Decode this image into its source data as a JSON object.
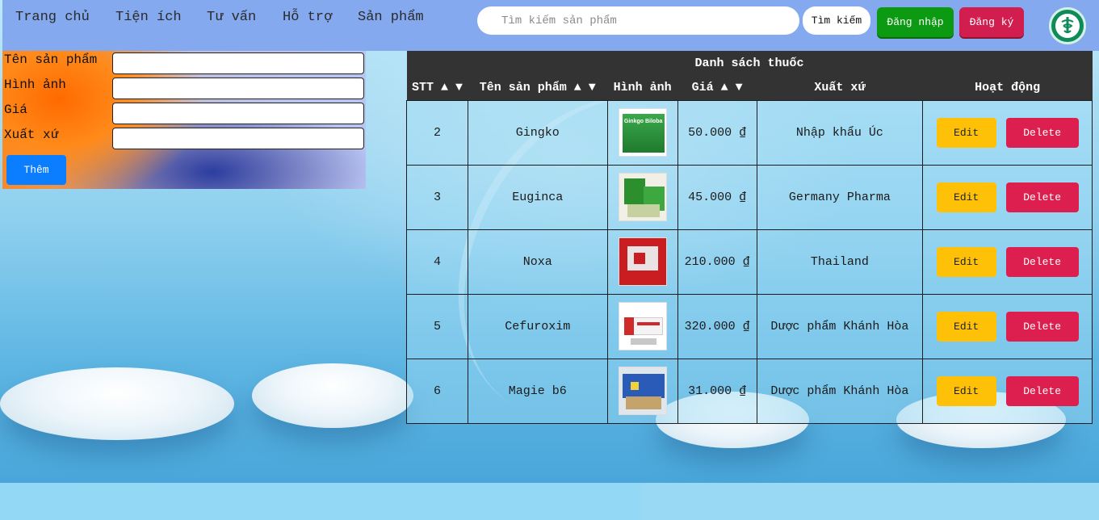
{
  "nav": {
    "items": [
      {
        "label": "Trang chủ"
      },
      {
        "label": "Tiện ích"
      },
      {
        "label": "Tư vấn"
      },
      {
        "label": "Hỗ trợ"
      },
      {
        "label": "Sản phẩm"
      }
    ],
    "search_placeholder": "Tìm kiếm sản phẩm",
    "search_button": "Tìm kiếm",
    "login_button": "Đăng nhập",
    "signup_button": "Đăng ký",
    "logo_icon": "pharmacy-caduceus-icon"
  },
  "form": {
    "name_label": "Tên sản phẩm",
    "image_label": "Hình ảnh",
    "price_label": "Giá",
    "origin_label": "Xuất xứ",
    "name_value": "",
    "image_value": "",
    "price_value": "",
    "origin_value": "",
    "add_button": "Thêm"
  },
  "table": {
    "caption": "Danh sách thuốc",
    "headers": {
      "stt": "STT ▲ ▼",
      "name": "Tên sản phẩm ▲ ▼",
      "image": "Hình ảnh",
      "price": "Giá ▲ ▼",
      "origin": "Xuất xứ",
      "actions": "Hoạt động"
    },
    "edit_label": "Edit",
    "delete_label": "Delete",
    "rows": [
      {
        "stt": "2",
        "name": "Gingko",
        "price": "50.000 ₫",
        "origin": "Nhập khẩu Úc"
      },
      {
        "stt": "3",
        "name": "Euginca",
        "price": "45.000 ₫",
        "origin": "Germany Pharma"
      },
      {
        "stt": "4",
        "name": "Noxa",
        "price": "210.000 ₫",
        "origin": "Thailand"
      },
      {
        "stt": "5",
        "name": "Cefuroxim",
        "price": "320.000 ₫",
        "origin": "Dược phẩm Khánh Hòa"
      },
      {
        "stt": "6",
        "name": "Magie b6",
        "price": "31.000 ₫",
        "origin": "Dược phẩm Khánh Hòa"
      }
    ],
    "thumb_texts": {
      "gingko": "Ginkgo Biloba"
    },
    "colors": {
      "header_bg": "#333333",
      "edit": "#ffc107",
      "delete": "#dc1f4f",
      "login": "#0c9a12",
      "signup": "#d11e4f",
      "add": "#0b7dff"
    }
  }
}
